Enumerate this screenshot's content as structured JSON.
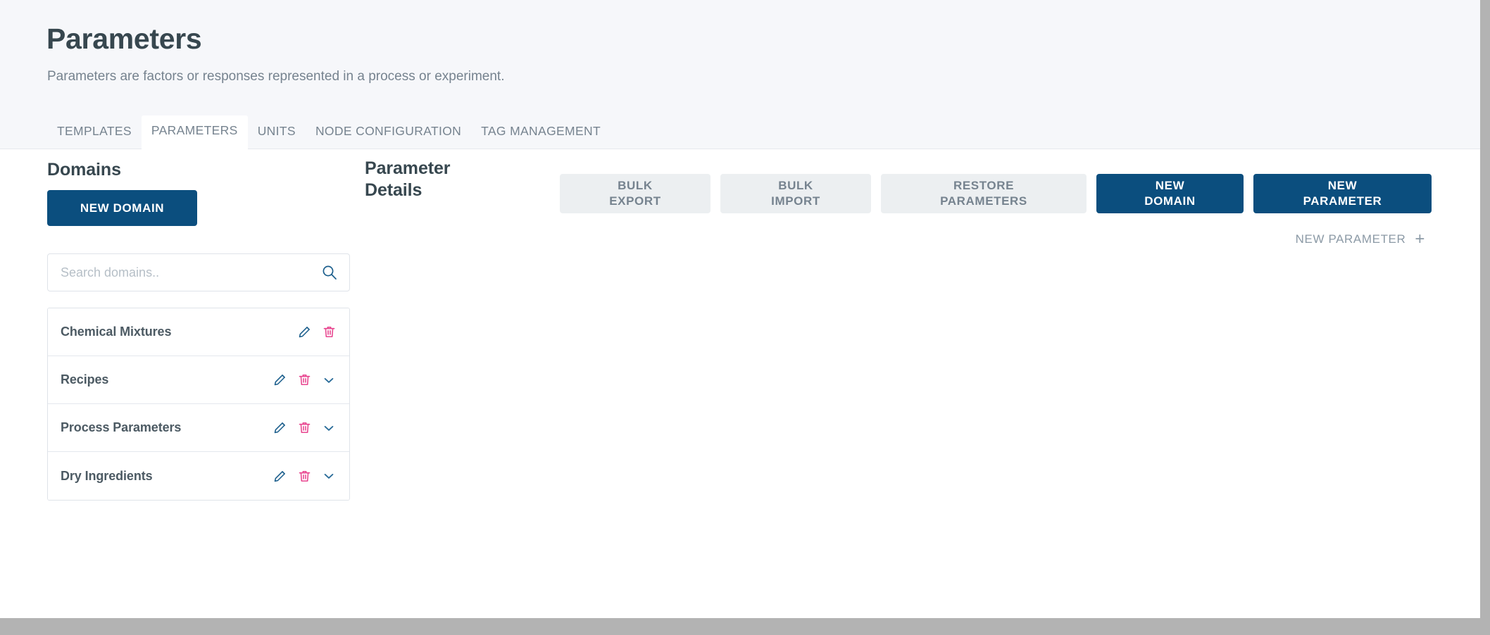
{
  "header": {
    "title": "Parameters",
    "subtitle": "Parameters are factors or responses represented in a process or experiment."
  },
  "tabs": [
    {
      "label": "TEMPLATES",
      "active": false
    },
    {
      "label": "PARAMETERS",
      "active": true
    },
    {
      "label": "UNITS",
      "active": false
    },
    {
      "label": "NODE CONFIGURATION",
      "active": false
    },
    {
      "label": "TAG MANAGEMENT",
      "active": false
    }
  ],
  "sidebar": {
    "title": "Domains",
    "new_domain_label": "NEW DOMAIN",
    "search": {
      "placeholder": "Search domains..",
      "value": "",
      "icon": "search-icon"
    },
    "items": [
      {
        "name": "Chemical Mixtures",
        "has_expand": false
      },
      {
        "name": "Recipes",
        "has_expand": true
      },
      {
        "name": "Process Parameters",
        "has_expand": true
      },
      {
        "name": "Dry Ingredients",
        "has_expand": true
      }
    ],
    "row_icons": {
      "edit": "pencil-icon",
      "delete": "trash-icon",
      "expand": "chevron-down-icon"
    }
  },
  "main": {
    "details_title": "Parameter\nDetails",
    "actions": [
      {
        "label": "BULK\nEXPORT",
        "style": "secondary",
        "name": "bulk-export-button"
      },
      {
        "label": "BULK\nIMPORT",
        "style": "secondary",
        "name": "bulk-import-button"
      },
      {
        "label": "RESTORE\nPARAMETERS",
        "style": "secondary",
        "name": "restore-parameters-button"
      },
      {
        "label": "NEW\nDOMAIN",
        "style": "primary",
        "name": "new-domain-action-button"
      },
      {
        "label": "NEW\nPARAMETER",
        "style": "primary",
        "name": "new-parameter-action-button"
      }
    ],
    "new_parameter_link": {
      "label": "NEW PARAMETER",
      "icon": "plus-icon"
    }
  },
  "colors": {
    "brand_blue": "#0b4e7e",
    "accent_pink": "#e8458f",
    "icon_blue": "#1b5e8c",
    "text_dark": "#37474f",
    "text_muted": "#76838f",
    "header_bg": "#f6f7fa",
    "button_gray": "#eceff1",
    "border": "#dfe3e9",
    "frame_gray": "#b3b3b3"
  }
}
